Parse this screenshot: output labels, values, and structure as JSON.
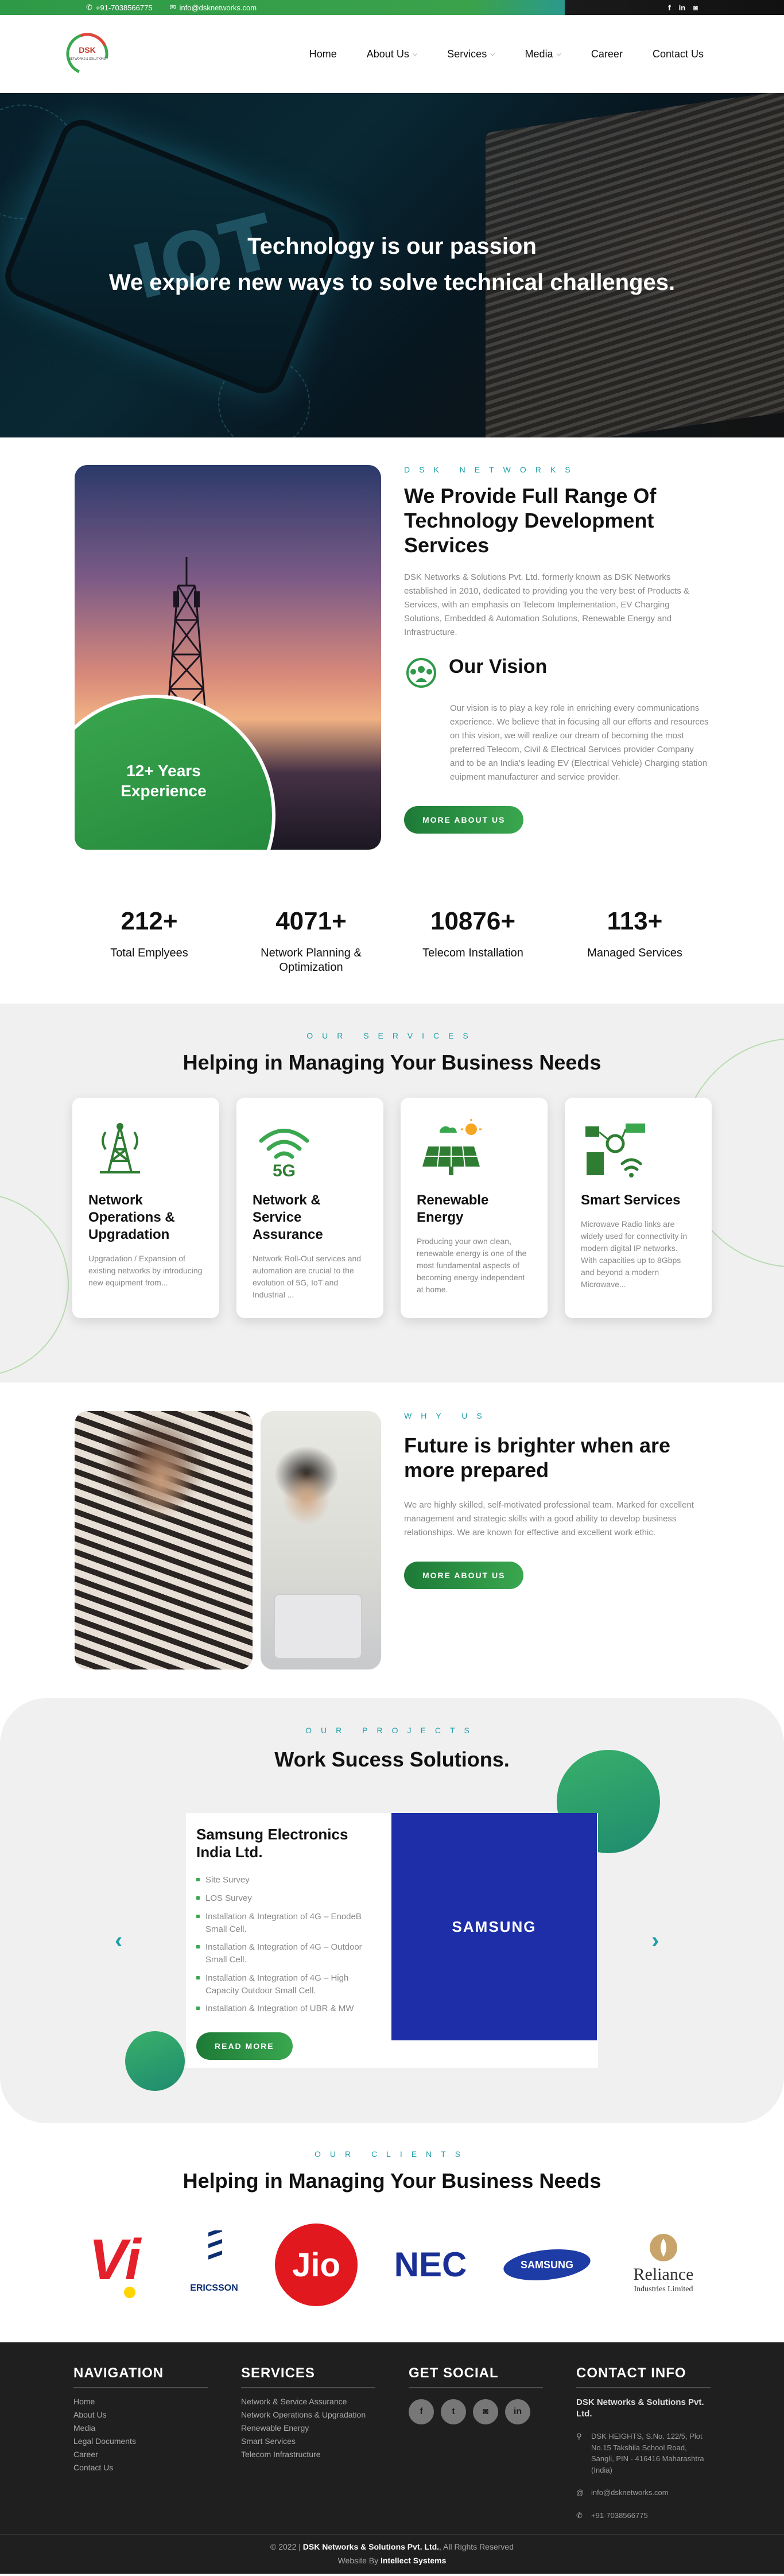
{
  "topbar": {
    "phone": "+91-7038566775",
    "email": "info@dsknetworks.com",
    "social": [
      "f",
      "in",
      "ig"
    ]
  },
  "header": {
    "logo_text": "DSK",
    "logo_sub": "NETWORKS & SOLUTIONS",
    "nav": [
      {
        "label": "Home",
        "has_dropdown": false
      },
      {
        "label": "About Us",
        "has_dropdown": true
      },
      {
        "label": "Services",
        "has_dropdown": true
      },
      {
        "label": "Media",
        "has_dropdown": true
      },
      {
        "label": "Career",
        "has_dropdown": false
      },
      {
        "label": "Contact Us",
        "has_dropdown": false
      }
    ]
  },
  "hero": {
    "line1": "Technology is our passion",
    "line2": "We explore new ways to solve technical challenges.",
    "image_text": "IOT"
  },
  "about": {
    "eyebrow": "DSK NETWORKS",
    "title": "We Provide Full Range Of Technology Development Services",
    "text": "DSK Networks & Solutions Pvt. Ltd. formerly known as DSK Networks established in 2010, dedicated to providing you the very best of Products & Services, with an emphasis on Telecom Implementation, EV Charging Solutions, Embedded & Automation Solutions, Renewable Energy and Infrastructure.",
    "badge": "12+ Years Experience",
    "vision_title": "Our Vision",
    "vision_text": "Our vision is to play a key role in enriching every communications experience. We believe that in focusing all our efforts and resources on this vision, we will realize our dream of becoming the most preferred Telecom, Civil & Electrical Services provider Company and to be an India's leading EV (Electrical Vehicle) Charging station euipment manufacturer and service provider.",
    "button": "MORE ABOUT US"
  },
  "stats": [
    {
      "num": "212+",
      "label": "Total Emplyees"
    },
    {
      "num": "4071+",
      "label": "Network Planning & Optimization"
    },
    {
      "num": "10876+",
      "label": "Telecom Installation"
    },
    {
      "num": "113+",
      "label": "Managed Services"
    }
  ],
  "services": {
    "eyebrow": "OUR SERVICES",
    "title": "Helping in Managing Your Business Needs",
    "items": [
      {
        "title": "Network Operations & Upgradation",
        "text": "Upgradation / Expansion of existing networks by introducing new equipment from...",
        "icon": "tower-icon"
      },
      {
        "title": "Network & Service Assurance",
        "text": "Network Roll-Out services and automation are crucial to the evolution of 5G, IoT and Industrial ...",
        "icon": "wifi-5g-icon"
      },
      {
        "title": "Renewable Energy",
        "text": "Producing your own clean, renewable energy is one of the most fundamental aspects of becoming energy independent at home.",
        "icon": "solar-panel-icon"
      },
      {
        "title": "Smart Services",
        "text": "Microwave Radio links are widely used for connectivity in modern digital IP networks. With capacities up to 8Gbps and beyond a modern Microwave...",
        "icon": "smart-city-icon"
      }
    ]
  },
  "why": {
    "eyebrow": "WHY US",
    "title": "Future is brighter when are more prepared",
    "text": "We are highly skilled, self-motivated professional team. Marked for excellent management and strategic skills with a good ability to develop business relationships. We are known for effective and excellent work ethic.",
    "button": "MORE ABOUT US"
  },
  "projects": {
    "eyebrow": "OUR PROJECTS",
    "title": "Work Sucess Solutions.",
    "card": {
      "title": "Samsung Electronics India Ltd.",
      "items": [
        "Site Survey",
        "LOS Survey",
        "Installation & Integration of 4G – EnodeB Small Cell.",
        "Installation & Integration of 4G – Outdoor Small Cell.",
        "Installation & Integration of 4G – High Capacity Outdoor Small Cell.",
        "Installation & Integration of UBR & MW"
      ],
      "button": "READ MORE",
      "logo": "SAMSUNG"
    },
    "prev": "‹",
    "next": "›"
  },
  "clients": {
    "eyebrow": "OUR CLIENTS",
    "title": "Helping in Managing Your Business Needs",
    "logos": {
      "vi": "Vi",
      "ericsson": "ERICSSON",
      "jio": "Jio",
      "nec": "NEC",
      "samsung": "SAMSUNG",
      "reliance": "Reliance",
      "reliance_sub": "Industries Limited"
    }
  },
  "footer": {
    "nav_title": "NAVIGATION",
    "nav": [
      "Home",
      "About Us",
      "Media",
      "Legal Documents",
      "Career",
      "Contact Us"
    ],
    "services_title": "SERVICES",
    "services": [
      "Network & Service Assurance",
      "Network Operations & Upgradation",
      "Renewable Energy",
      "Smart Services",
      "Telecom Infrastructure"
    ],
    "social_title": "GET SOCIAL",
    "social": [
      "f",
      "t",
      "ig",
      "in"
    ],
    "contact_title": "CONTACT INFO",
    "company": "DSK Networks & Solutions Pvt. Ltd.",
    "address": "DSK HEIGHTS, S.No. 122/5, Plot No.15 Takshila School Road, Sangli, PIN - 416416 Maharashtra (India)",
    "email": "info@dsknetworks.com",
    "phone": "+91-7038566775",
    "copyright_pre": "© 2022 |",
    "copyright_company": "DSK Networks & Solutions Pvt. Ltd.",
    "copyright_post": "All Rights Reserved",
    "website_by": "Website By",
    "website_company": "Intellect Systems"
  },
  "colors": {
    "accent_green": "#3aa74f",
    "accent_teal": "#1fa0a9",
    "footer_bg": "#1f1f1f"
  }
}
